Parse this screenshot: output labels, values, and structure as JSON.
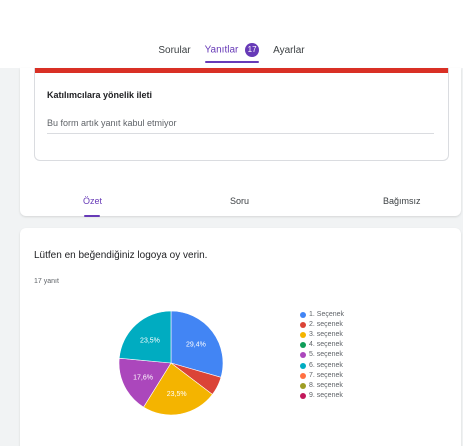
{
  "top_tabs": [
    {
      "label": "Sorular",
      "active": false
    },
    {
      "label": "Yanıtlar",
      "active": true,
      "badge": "17"
    },
    {
      "label": "Ayarlar",
      "active": false
    }
  ],
  "responses_card": {
    "message_label": "Katılımcılara yönelik ileti",
    "message_text": "Bu form artık yanıt kabul etmiyor",
    "sub_tabs": [
      {
        "label": "Özet",
        "active": true
      },
      {
        "label": "Soru",
        "active": false
      },
      {
        "label": "Bağımsız",
        "active": false
      }
    ]
  },
  "question": {
    "title": "Lütfen en beğendiğiniz logoya oy verin.",
    "response_count": "17 yanıt"
  },
  "chart_data": {
    "type": "pie",
    "categories": [
      "1. Seçenek",
      "2. seçenek",
      "3. seçenek",
      "4. seçenek",
      "5. seçenek",
      "6. seçenek",
      "7. seçenek",
      "8. seçenek",
      "9. seçenek"
    ],
    "values": [
      29.4,
      5.9,
      23.5,
      0,
      17.6,
      23.5,
      0,
      0,
      0
    ],
    "slice_labels": [
      "29,4%",
      "",
      "23,5%",
      "",
      "17,6%",
      "23,5%",
      "",
      "",
      ""
    ],
    "colors": [
      "#4285f4",
      "#db4437",
      "#f4b400",
      "#0f9d58",
      "#ab47bc",
      "#00acc1",
      "#ff7043",
      "#9e9d24",
      "#c2185b"
    ],
    "legend_placement": "right"
  }
}
